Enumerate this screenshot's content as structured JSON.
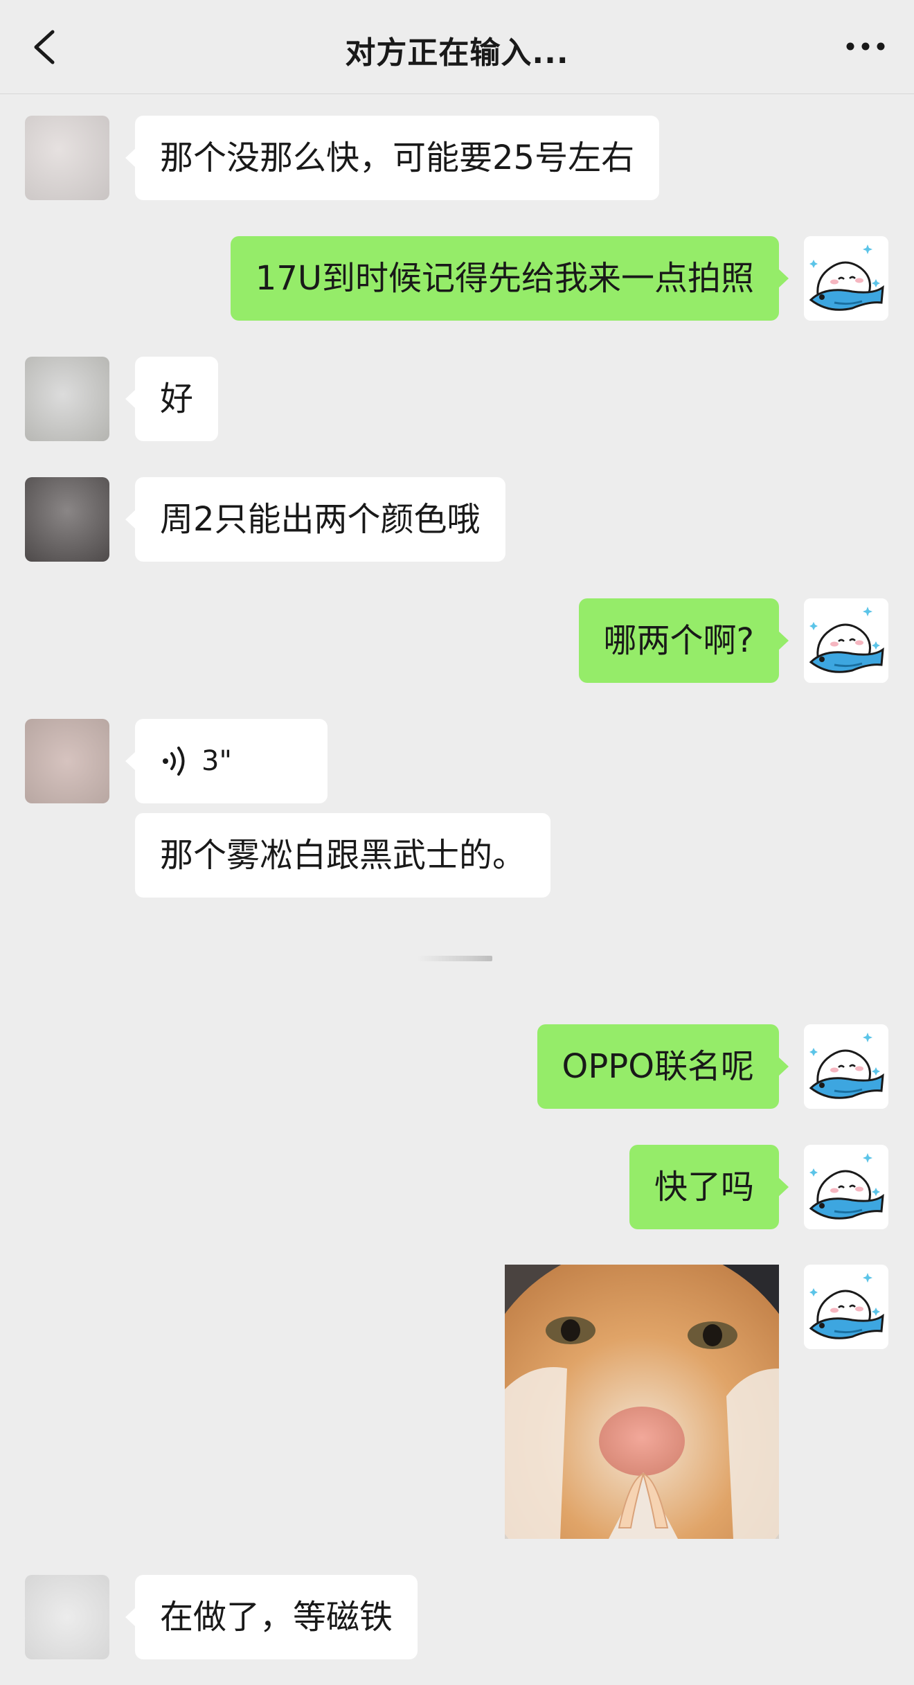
{
  "header": {
    "title": "对方正在输入...",
    "back_icon": "chevron-left-icon",
    "more_icon": "more-dots-icon"
  },
  "colors": {
    "background": "#ededed",
    "received_bubble": "#ffffff",
    "sent_bubble": "#95ec69",
    "text": "#191919"
  },
  "messages": [
    {
      "from": "them",
      "type": "text",
      "text": "那个没那么快，可能要25号左右"
    },
    {
      "from": "me",
      "type": "text",
      "text": "17U到时候记得先给我来一点拍照"
    },
    {
      "from": "them",
      "type": "text",
      "text": "好"
    },
    {
      "from": "them",
      "type": "text",
      "text": "周2只能出两个颜色哦"
    },
    {
      "from": "me",
      "type": "text",
      "text": "哪两个啊?"
    },
    {
      "from": "them",
      "type": "voice",
      "duration": "3\""
    },
    {
      "from": "them",
      "type": "text",
      "text": "那个雾凇白跟黑武士的。"
    },
    {
      "from": "me",
      "type": "text",
      "text": "OPPO联名呢"
    },
    {
      "from": "me",
      "type": "text",
      "text": "快了吗"
    },
    {
      "from": "me",
      "type": "sticker",
      "sticker": "cat-praying-hands-sticker"
    },
    {
      "from": "them",
      "type": "text",
      "text": "在做了，等磁铁"
    }
  ],
  "avatars": {
    "me": "rice-ball-riding-fish-avatar",
    "them": "blurred-photo-avatar"
  }
}
